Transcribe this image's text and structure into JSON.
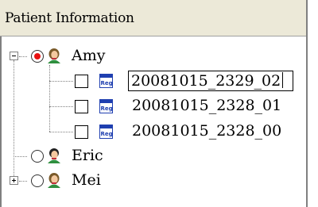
{
  "panel": {
    "title": "Patient Information"
  },
  "tree": {
    "patients": [
      {
        "name": "Amy",
        "selected": true,
        "expanded": true
      },
      {
        "name": "Eric",
        "selected": false,
        "expanded": false
      },
      {
        "name": "Mei",
        "selected": false,
        "expanded": false
      }
    ],
    "registrations": [
      {
        "id": "20081015_2329_02",
        "editing": true,
        "checked": false
      },
      {
        "id": "20081015_2328_01",
        "editing": false,
        "checked": false
      },
      {
        "id": "20081015_2328_00",
        "editing": false,
        "checked": false
      }
    ],
    "reg_icon_label": "Reg"
  },
  "colors": {
    "header_bg": "#ece9d8",
    "radio_selected": "#e81010",
    "reg_icon_blue": "#1f3fb0"
  },
  "icons": {
    "expander_minus": "minus-box-icon",
    "expander_plus": "plus-box-icon",
    "person": "patient-person-icon",
    "reg": "reg-document-icon"
  }
}
